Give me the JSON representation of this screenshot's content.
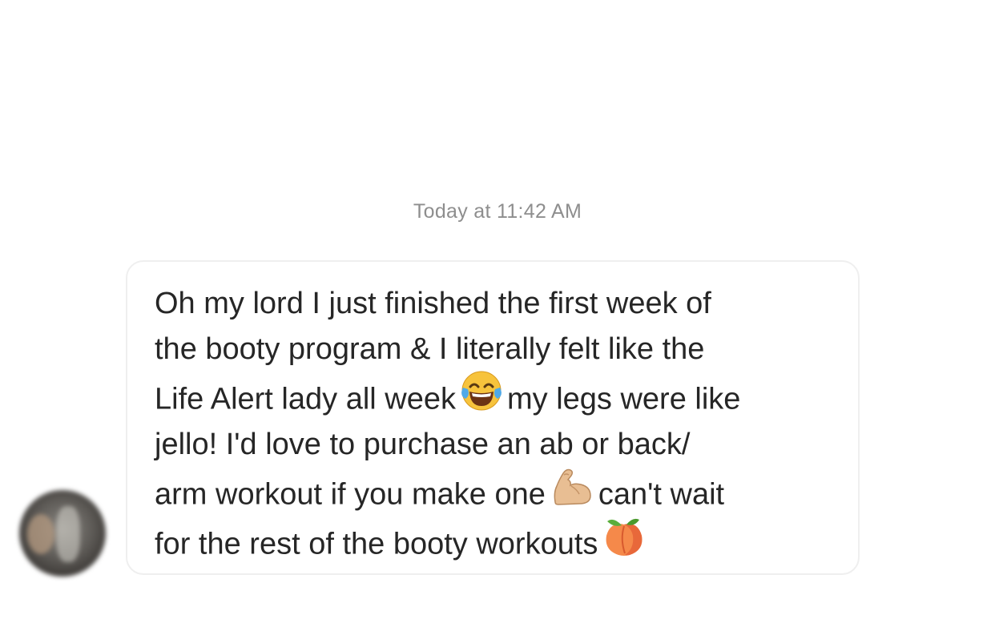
{
  "conversation": {
    "timestamp": "Today at 11:42 AM"
  },
  "message": {
    "lines": [
      {
        "text": "Oh my lord I just finished the first week of"
      },
      {
        "text": "the booty program & I literally felt like the"
      },
      {
        "before": "Life Alert lady all week",
        "emoji": "face-with-tears-of-joy-icon",
        "after": "my legs were like"
      },
      {
        "text": "jello! I'd love to purchase an ab or back/"
      },
      {
        "before": "arm workout if you make one",
        "emoji": "flexed-biceps-icon",
        "after": "can't wait"
      },
      {
        "before": "for the rest of the booty workouts",
        "emoji": "peach-icon",
        "after": ""
      }
    ]
  },
  "avatar": {
    "icon": "blurred-profile-avatar"
  }
}
